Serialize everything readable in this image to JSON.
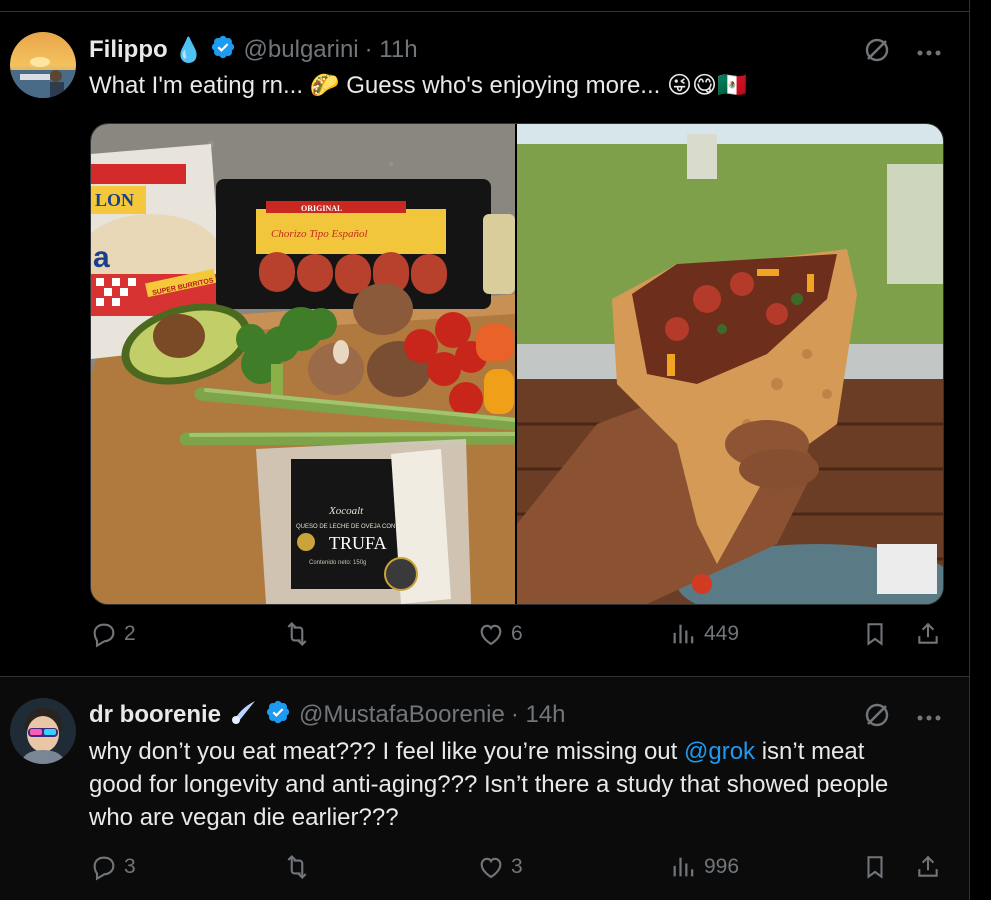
{
  "tweets": [
    {
      "name": "Filippo",
      "name_emoji": "💧",
      "handle": "@bulgarini",
      "time": "· 11h",
      "text_parts": [
        "What I'm eating rn... ",
        "🌮",
        " Guess who's enjoying more... ",
        "😜😋🇲🇽"
      ],
      "media_labels": {
        "tortilla_brand": "LON",
        "tortilla_text": "SUPER BURRITOS",
        "chorizo_label": "Chorizo Tipo Español",
        "chorizo_brand": "ORIGINAL",
        "cheese_brand": "Xocoalt",
        "cheese_desc": "QUESO DE LECHE DE OVEJA CON",
        "cheese_type": "TRUFA",
        "cheese_net": "Contenido neto: 150g"
      },
      "stats": {
        "replies": "2",
        "reposts": "",
        "likes": "6",
        "views": "449"
      }
    },
    {
      "name": "dr boorenie",
      "handle": "@MustafaBoorenie",
      "time": "· 14h",
      "lines": [
        [
          "why don’t you eat meat??? I feel like you’re missing out ",
          "@grok",
          " isn’t meat"
        ],
        [
          "good for longevity and anti-aging??? Isn’t there a study that showed people"
        ],
        [
          "who are vegan die earlier???"
        ]
      ],
      "stats": {
        "replies": "3",
        "reposts": "",
        "likes": "3",
        "views": "996"
      }
    }
  ],
  "colors": {
    "accent": "#1d9bf0",
    "muted": "#71767b",
    "text": "#e7e9ea",
    "bg": "#000000"
  },
  "icons": [
    "verified-badge-icon",
    "grok-icon",
    "more-icon",
    "reply-icon",
    "repost-icon",
    "like-icon",
    "views-icon",
    "bookmark-icon",
    "share-icon"
  ]
}
